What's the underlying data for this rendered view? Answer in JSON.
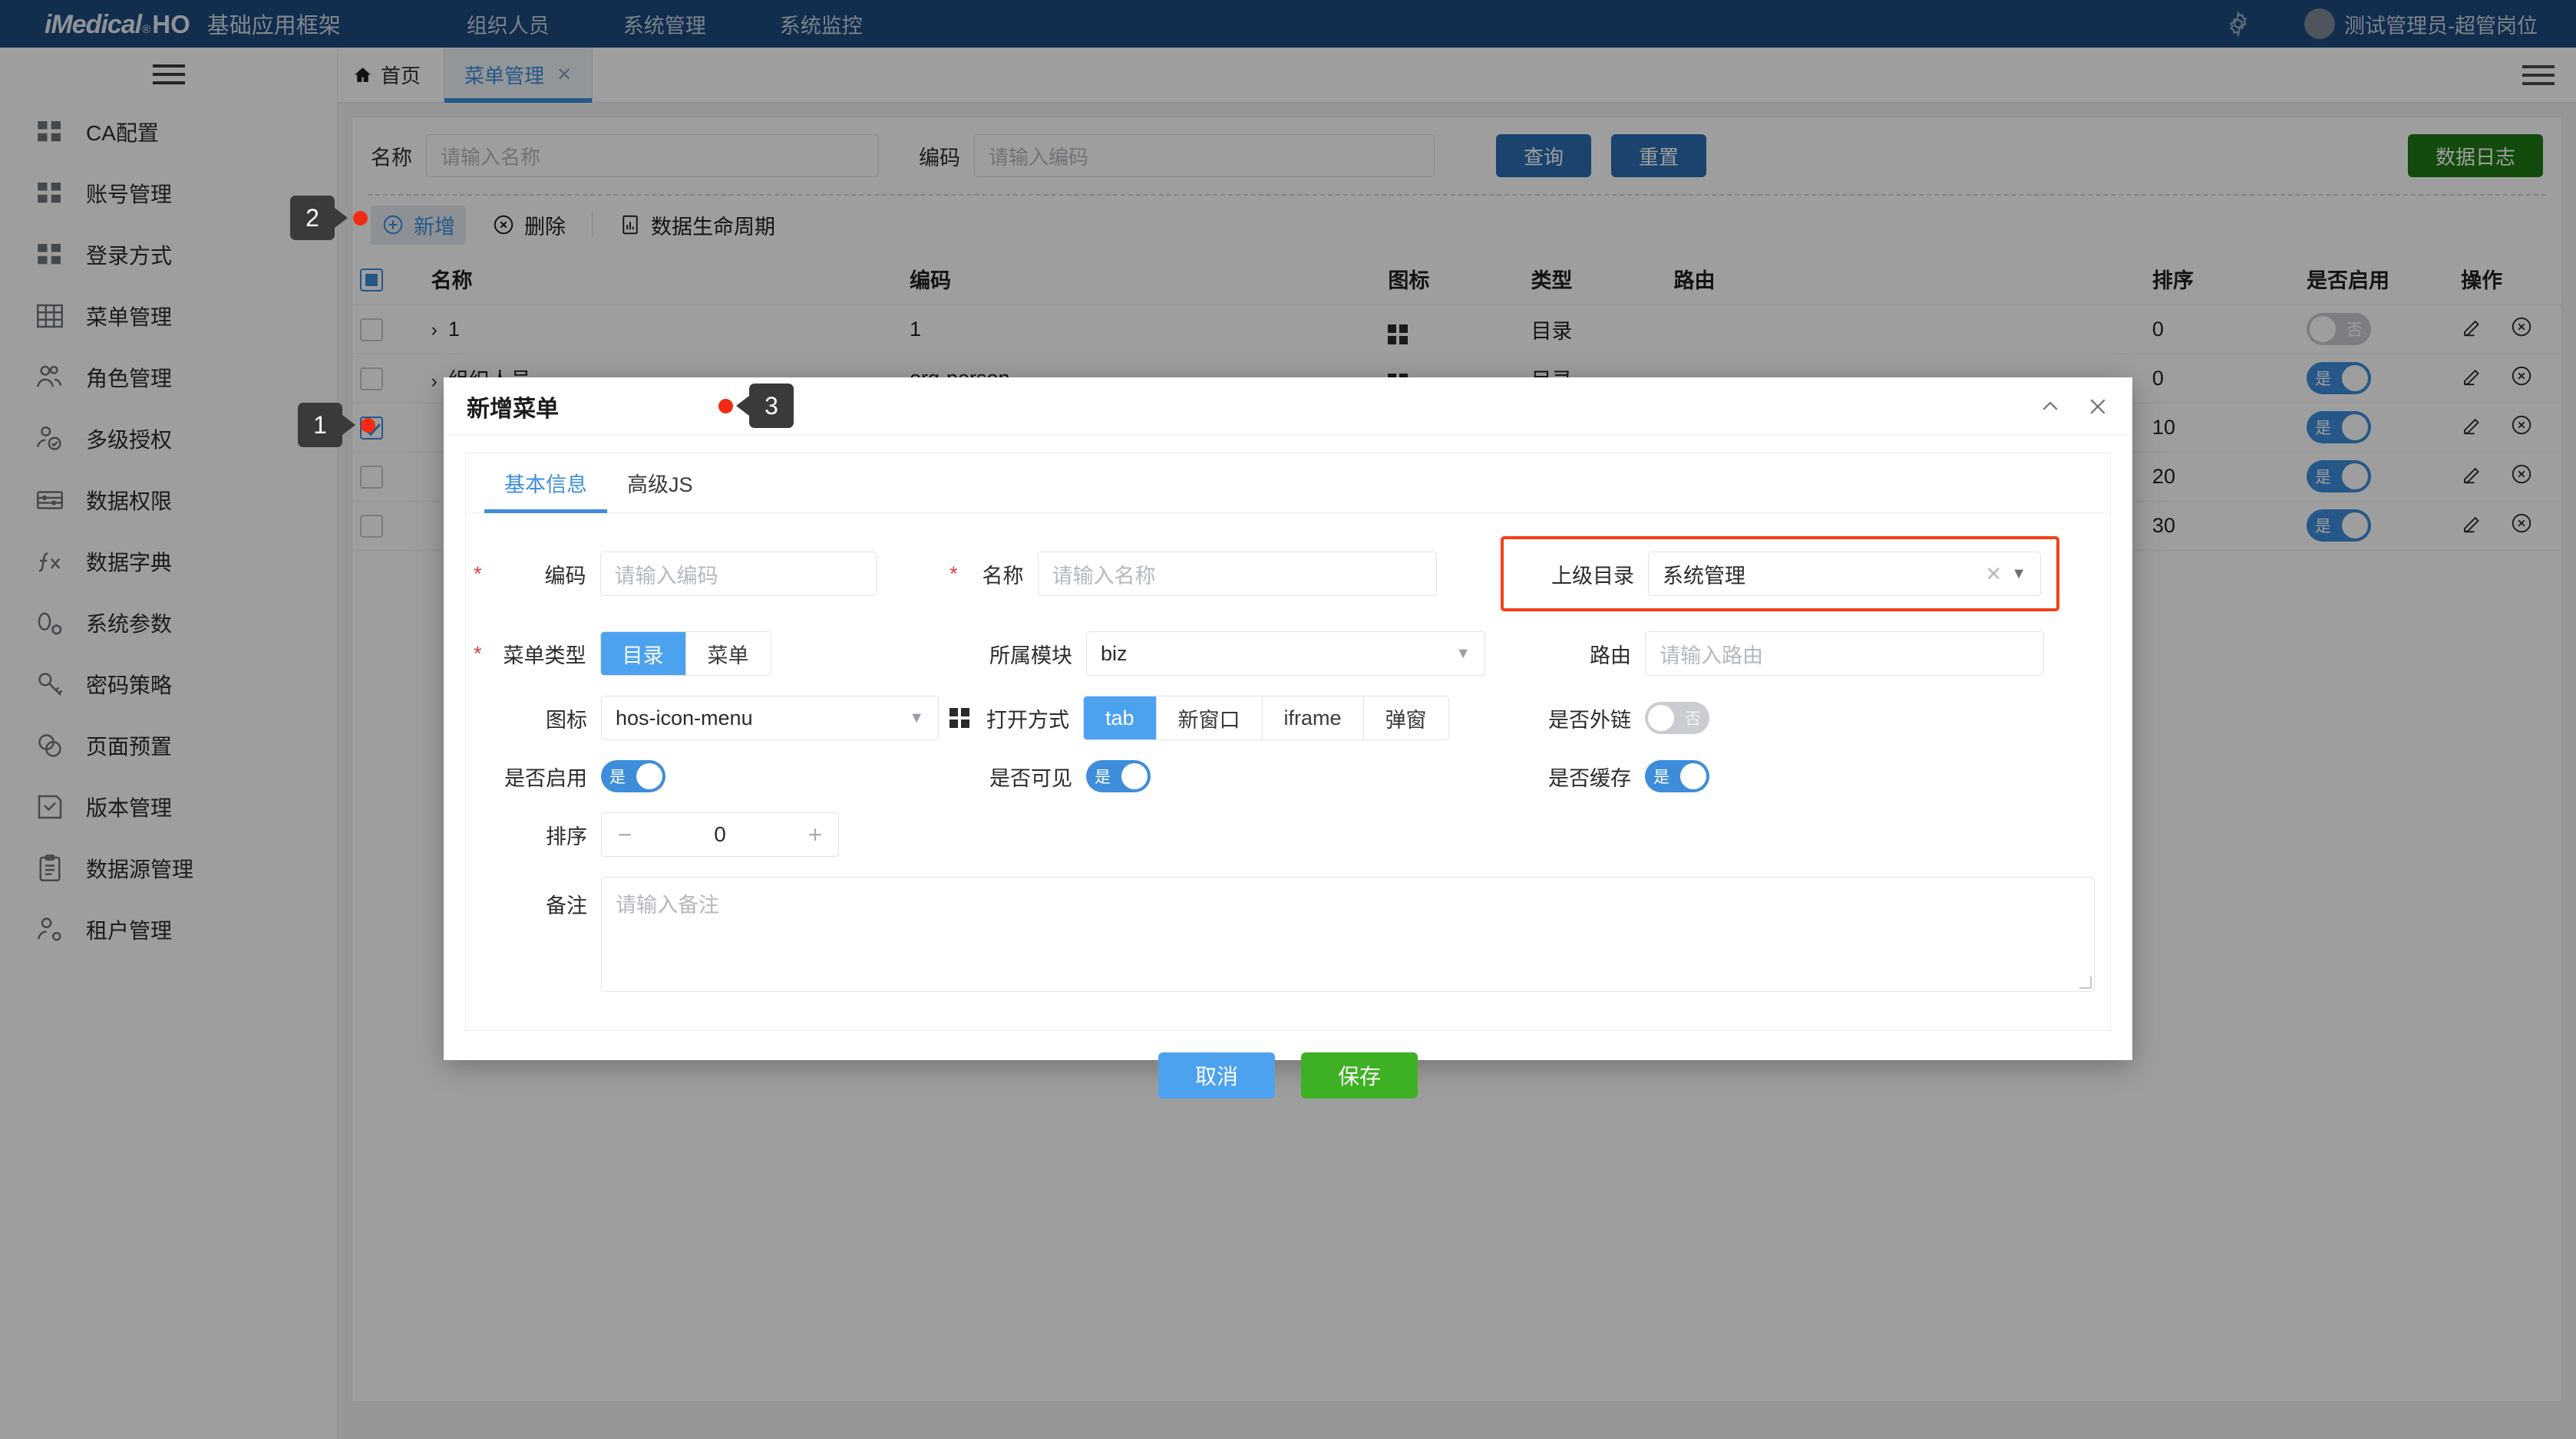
{
  "header": {
    "brand_i": "iMedical",
    "brand_reg": "®",
    "brand_ho": "HO",
    "brand_sub": "基础应用框架",
    "nav": [
      {
        "label": "组织人员"
      },
      {
        "label": "系统管理"
      },
      {
        "label": "系统监控"
      }
    ],
    "gear_icon": "gear-icon",
    "avatar_icon": "avatar",
    "username": "测试管理员-超管岗位"
  },
  "sidebar": {
    "menu_icon": "hamburger-icon",
    "items": [
      {
        "label": "CA配置",
        "icon": "grid-squares-icon"
      },
      {
        "label": "账号管理",
        "icon": "grid-squares-icon"
      },
      {
        "label": "登录方式",
        "icon": "grid-squares-icon"
      },
      {
        "label": "菜单管理",
        "icon": "table-grid-icon"
      },
      {
        "label": "角色管理",
        "icon": "users-icon"
      },
      {
        "label": "多级授权",
        "icon": "user-check-icon"
      },
      {
        "label": "数据权限",
        "icon": "abacus-icon"
      },
      {
        "label": "数据字典",
        "icon": "function-fx-icon"
      },
      {
        "label": "系统参数",
        "icon": "param-gear-icon"
      },
      {
        "label": "密码策略",
        "icon": "key-icon"
      },
      {
        "label": "页面预置",
        "icon": "circles-overlap-icon"
      },
      {
        "label": "版本管理",
        "icon": "save-check-icon"
      },
      {
        "label": "数据源管理",
        "icon": "clipboard-icon"
      },
      {
        "label": "租户管理",
        "icon": "user-gear-icon"
      }
    ]
  },
  "tabbar": {
    "home_icon": "home-icon",
    "home_label": "首页",
    "tabs": [
      {
        "label": "菜单管理",
        "close_icon": "close-icon",
        "active": true
      }
    ],
    "right_menu_icon": "hamburger-icon"
  },
  "search": {
    "name_label": "名称",
    "name_placeholder": "请输入名称",
    "name_value": "",
    "code_label": "编码",
    "code_placeholder": "请输入编码",
    "code_value": "",
    "query_button": "查询",
    "reset_button": "重置",
    "datalog_button": "数据日志"
  },
  "toolbar": {
    "add_label": "新增",
    "add_icon": "plus-circle-icon",
    "delete_label": "删除",
    "delete_icon": "x-circle-icon",
    "lifecycle_label": "数据生命周期",
    "lifecycle_icon": "chart-doc-icon"
  },
  "table": {
    "columns": [
      "名称",
      "编码",
      "图标",
      "类型",
      "路由",
      "排序",
      "是否启用",
      "操作"
    ],
    "rows": [
      {
        "name": "1",
        "code": "1",
        "icon": "grid-squares-icon",
        "type": "目录",
        "route": "",
        "sort": "0",
        "enabled": false,
        "enabled_label": "否",
        "checked": false
      },
      {
        "name": "组织人员",
        "code": "org-person",
        "icon": "grid-squares-icon",
        "type": "目录",
        "route": "",
        "sort": "0",
        "enabled": true,
        "enabled_label": "是",
        "checked": false
      },
      {
        "name": "",
        "code": "",
        "icon": "",
        "type": "",
        "route": "",
        "sort": "10",
        "enabled": true,
        "enabled_label": "是",
        "checked": true
      },
      {
        "name": "",
        "code": "",
        "icon": "",
        "type": "",
        "route": "",
        "sort": "20",
        "enabled": true,
        "enabled_label": "是",
        "checked": false
      },
      {
        "name": "",
        "code": "",
        "icon": "",
        "type": "",
        "route": "",
        "sort": "30",
        "enabled": true,
        "enabled_label": "是",
        "checked": false
      }
    ],
    "edit_icon": "pencil-icon",
    "delete_icon": "x-circle-icon"
  },
  "dialog": {
    "title": "新增菜单",
    "collapse_icon": "chevron-up-icon",
    "close_icon": "close-icon",
    "tabs": [
      {
        "label": "基本信息",
        "active": true
      },
      {
        "label": "高级JS",
        "active": false
      }
    ],
    "form": {
      "code_label": "编码",
      "code_placeholder": "请输入编码",
      "code_value": "",
      "name_label": "名称",
      "name_placeholder": "请输入名称",
      "name_value": "",
      "parent_label": "上级目录",
      "parent_value": "系统管理",
      "parent_clear_icon": "clear-x-icon",
      "parent_caret_icon": "chevron-down-icon",
      "menutype_label": "菜单类型",
      "menutype_options": [
        "目录",
        "菜单"
      ],
      "menutype_selected": "目录",
      "module_label": "所属模块",
      "module_value": "biz",
      "module_caret_icon": "chevron-down-icon",
      "route_label": "路由",
      "route_placeholder": "请输入路由",
      "route_value": "",
      "icon_label": "图标",
      "icon_value": "hos-icon-menu",
      "icon_caret_icon": "chevron-down-icon",
      "icon_preview": "grid-squares-icon",
      "opentype_label": "打开方式",
      "opentype_options": [
        "tab",
        "新窗口",
        "iframe",
        "弹窗"
      ],
      "opentype_selected": "tab",
      "external_label": "是否外链",
      "external_value": "否",
      "external_on": false,
      "enabled_label": "是否启用",
      "enabled_value": "是",
      "enabled_on": true,
      "visible_label": "是否可见",
      "visible_value": "是",
      "visible_on": true,
      "cache_label": "是否缓存",
      "cache_value": "是",
      "cache_on": true,
      "sort_label": "排序",
      "sort_value": "0",
      "sort_minus": "−",
      "sort_plus": "+",
      "remark_label": "备注",
      "remark_placeholder": "请输入备注",
      "remark_value": ""
    },
    "cancel_button": "取消",
    "save_button": "保存"
  },
  "annotations": [
    {
      "id": "1",
      "label": "1"
    },
    {
      "id": "2",
      "label": "2"
    },
    {
      "id": "3",
      "label": "3"
    }
  ],
  "colors": {
    "header_blue": "#1d4a7c",
    "accent_blue": "#3d8ddb",
    "toggle_blue": "#4da2f0",
    "save_green": "#3db023",
    "datalog_green": "#1e7a14",
    "highlight_red": "#f4401a",
    "dot_red": "#f22b14"
  }
}
